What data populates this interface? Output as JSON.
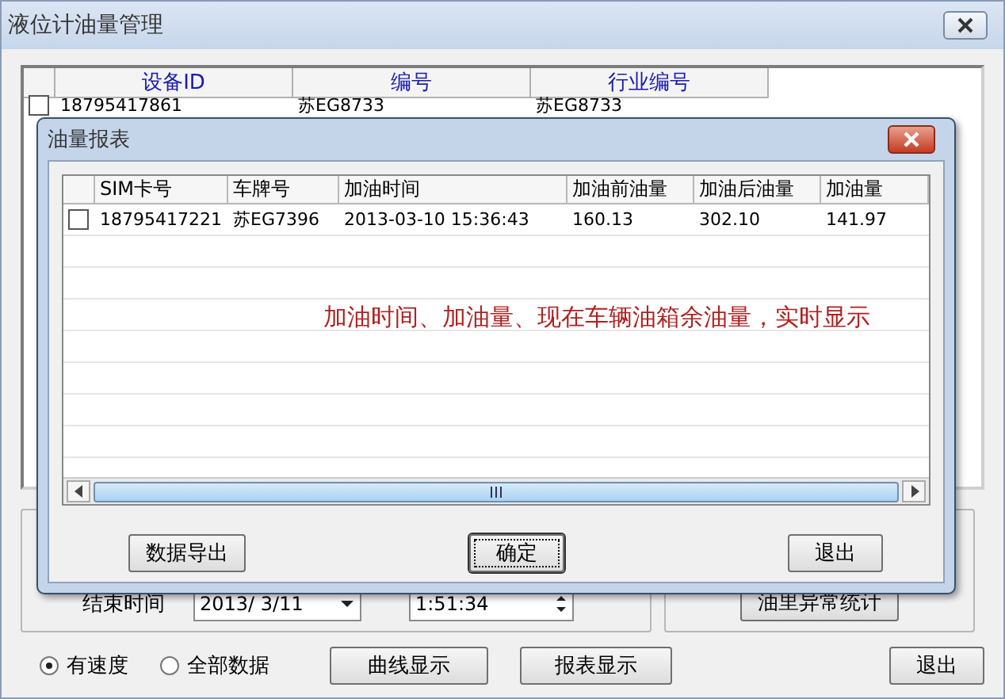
{
  "window": {
    "title": "液位计油量管理"
  },
  "device_list": {
    "columns": [
      "设备ID",
      "编号",
      "行业编号"
    ],
    "rows": [
      {
        "checked": false,
        "cells": [
          "18795417861",
          "苏EG8733",
          "苏EG8733"
        ]
      }
    ]
  },
  "end_time": {
    "label": "结束时间",
    "date": "2013/ 3/11",
    "time": "1:51:34"
  },
  "anomaly_button": "油里异常统计",
  "mode_options": [
    {
      "label": "有速度",
      "selected": true
    },
    {
      "label": "全部数据",
      "selected": false
    }
  ],
  "bottom_buttons": [
    "曲线显示",
    "报表显示"
  ],
  "exit_button": "退出",
  "dialog": {
    "title": "油量报表",
    "columns": [
      "SIM卡号",
      "车牌号",
      "加油时间",
      "加油前油量",
      "加油后油量",
      "加油量"
    ],
    "rows": [
      {
        "checked": false,
        "cells": [
          "18795417221",
          "苏EG7396",
          "2013-03-10 15:36:43",
          "160.13",
          "302.10",
          "141.97"
        ]
      }
    ],
    "annotation": "加油时间、加油量、现在车辆油箱余油量，实时显示",
    "buttons": [
      {
        "label": "数据导出",
        "focused": false
      },
      {
        "label": "确定",
        "focused": true
      },
      {
        "label": "退出",
        "focused": false
      }
    ]
  }
}
